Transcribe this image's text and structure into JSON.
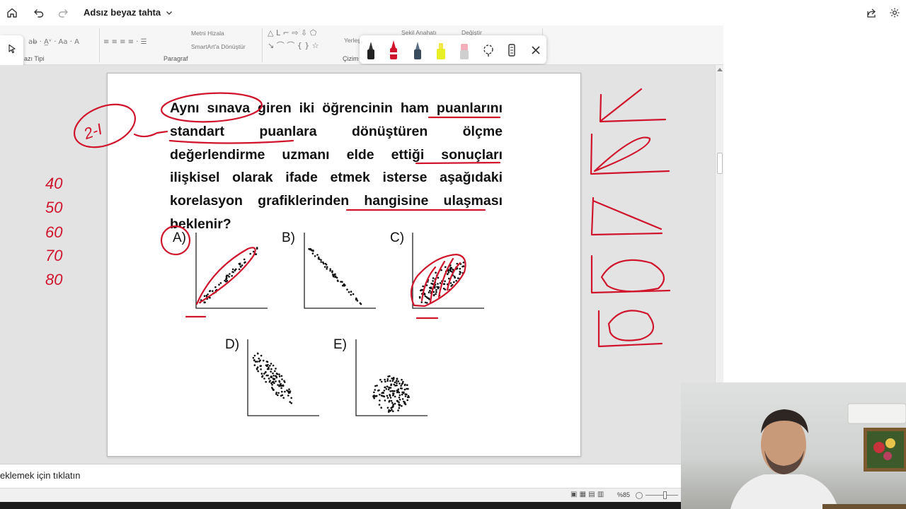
{
  "app": {
    "title": "Adsız beyaz tahta"
  },
  "ribbon": {
    "text_wrap": "Metni Hizala",
    "smartart": "SmartArt'a Dönüştür",
    "group_paragraph": "Paragraf",
    "group_font_fragment": "azı Tipi",
    "arrange_fragment": "Yerleş",
    "drawing_fragment": "Çizim",
    "shape_outline": "Şekil Anahatı",
    "change": "Değiştir"
  },
  "slide": {
    "question": "Aynı sınava giren iki öğrencinin ham puanlarını standart puanlara dönüştüren ölçme değerlendirme uzmanı elde ettiği sonuçları ilişkisel olarak ifade etmek isterse aşağıdaki korelasyon grafiklerinden hangisine ulaşması beklenir?",
    "options": [
      "A)",
      "B)",
      "C)",
      "D)",
      "E)"
    ]
  },
  "ink": {
    "circle_note": "2-I",
    "numbers": [
      "40",
      "50",
      "60",
      "70",
      "80"
    ]
  },
  "notes": {
    "placeholder": "eklemek için tıklatın"
  },
  "status": {
    "zoom": "%85"
  },
  "colors": {
    "ink_red": "#d0142c",
    "canvas_bg": "#e3e3e3"
  }
}
